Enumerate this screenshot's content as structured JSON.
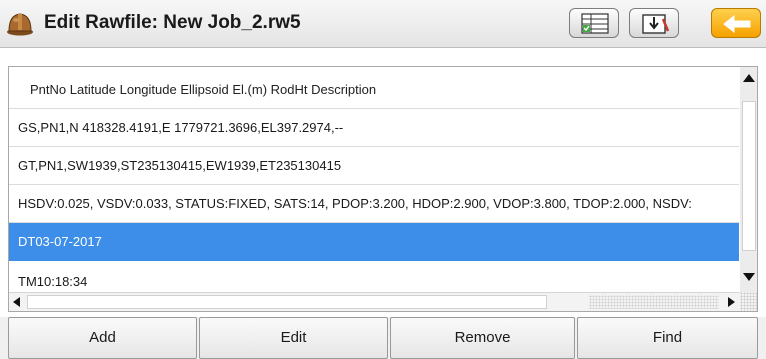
{
  "window": {
    "title": "Edit Rawfile: New Job_2.rw5",
    "icons": [
      "hardhat-icon",
      "table-check-icon",
      "export-icon",
      "back-arrow-icon"
    ]
  },
  "list": {
    "header": "PntNo    Latitude    Longitude    Ellipsoid El.(m)  RodHt  Description",
    "rows": [
      "GS,PN1,N 418328.4191,E 1779721.3696,EL397.2974,--",
      "GT,PN1,SW1939,ST235130415,EW1939,ET235130415",
      "HSDV:0.025, VSDV:0.033, STATUS:FIXED, SATS:14, PDOP:3.200, HDOP:2.900, VDOP:3.800, TDOP:2.000, NSDV:",
      "DT03-07-2017",
      "TM10:18:34"
    ],
    "selected_row": "DT03-07-2017"
  },
  "buttons": {
    "add": "Add",
    "edit": "Edit",
    "remove": "Remove",
    "find": "Find"
  },
  "colors": {
    "selection": "#3d8ee8",
    "back_button": "#f5a100"
  }
}
